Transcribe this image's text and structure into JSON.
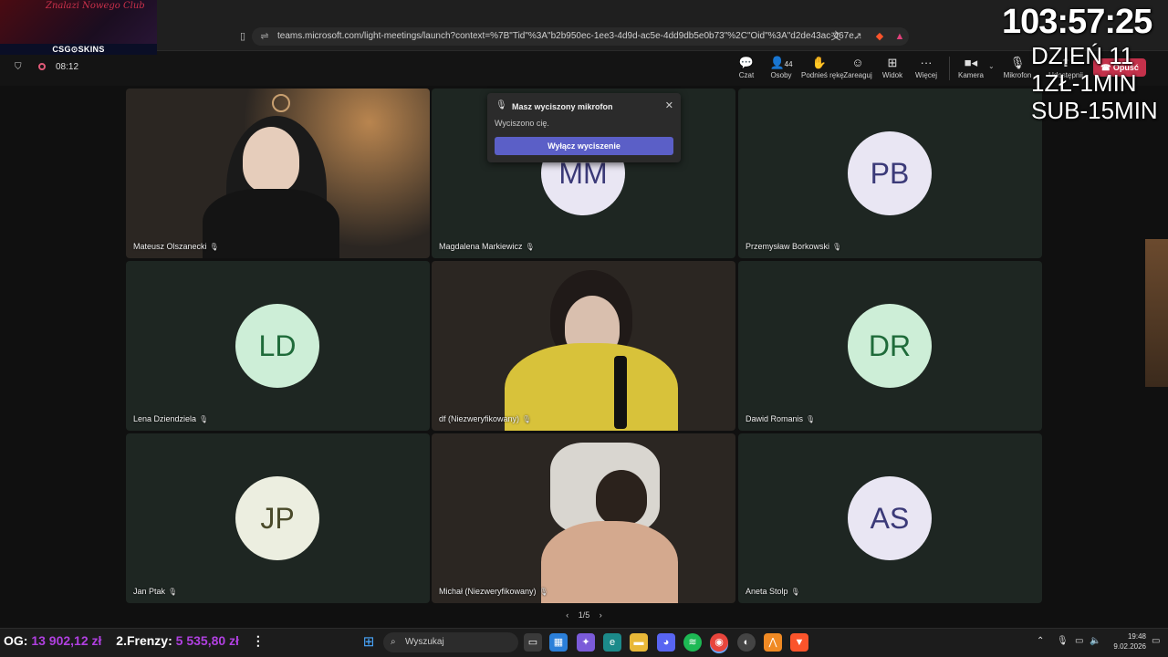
{
  "browser": {
    "url": "teams.microsoft.com/light-meetings/launch?context=%7B\"Tid\"%3A\"b2b950ec-1ee3-4d9d-ac5e-4dd9db5e0b73\"%2C\"Oid\"%3A\"d2de43ac-467e...",
    "stream_logo_script": "Znalazi Nowego Club",
    "stream_logo_sponsor": "CSG⊙SKINS"
  },
  "meeting": {
    "elapsed": "08:12",
    "toolbar": [
      {
        "label": "Czat",
        "icon": "chat-icon"
      },
      {
        "label": "Osoby",
        "icon": "people-icon",
        "count": "44"
      },
      {
        "label": "Podnieś rękę",
        "icon": "raise-hand-icon"
      },
      {
        "label": "Zareaguj",
        "icon": "react-icon"
      },
      {
        "label": "Widok",
        "icon": "view-icon"
      },
      {
        "label": "Więcej",
        "icon": "more-icon"
      },
      {
        "label": "Kamera",
        "icon": "camera-icon"
      },
      {
        "label": "Mikrofon",
        "icon": "mic-off-icon"
      },
      {
        "label": "Udostępnij",
        "icon": "share-icon"
      }
    ],
    "leave_label": "Opuść"
  },
  "overlay": {
    "timer": "103:57:25",
    "day": "DZIEŃ 11",
    "rate1": "1ZŁ-1MIN",
    "rate2": "SUB-15MIN"
  },
  "mute_popup": {
    "title": "Masz wyciszony mikrofon",
    "message": "Wyciszono cię.",
    "button": "Wyłącz wyciszenie"
  },
  "participants": [
    {
      "name": "Mateusz Olszanecki",
      "initials": "",
      "video": true
    },
    {
      "name": "Magdalena Markiewicz",
      "initials": "MM",
      "avatar_color": "#e9e6f3",
      "text_color": "#3b3a78"
    },
    {
      "name": "Przemysław Borkowski",
      "initials": "PB",
      "avatar_color": "#e9e6f3",
      "text_color": "#3b3a78"
    },
    {
      "name": "Lena Dziendziela",
      "initials": "LD",
      "avatar_color": "#cdeed7",
      "text_color": "#1f6b3a"
    },
    {
      "name": "df (Niezweryfikowany)",
      "initials": "",
      "video": true
    },
    {
      "name": "Dawid Romanis",
      "initials": "DR",
      "avatar_color": "#cdeed7",
      "text_color": "#1f6b3a"
    },
    {
      "name": "Jan Ptak",
      "initials": "JP",
      "avatar_color": "#eceee0",
      "text_color": "#4a4a2a"
    },
    {
      "name": "Michał (Niezweryfikowany)",
      "initials": "",
      "video": true
    },
    {
      "name": "Aneta Stolp",
      "initials": "AS",
      "avatar_color": "#e9e6f3",
      "text_color": "#3b3a78"
    }
  ],
  "pager": "1/5",
  "taskbar": {
    "og_label": "OG:",
    "og_value": "13 902,12 zł",
    "frenzy_label": "2.Frenzy:",
    "frenzy_value": "5 535,80 zł",
    "search_placeholder": "Wyszukaj",
    "time": "19:48",
    "date": "9.02.2026"
  }
}
